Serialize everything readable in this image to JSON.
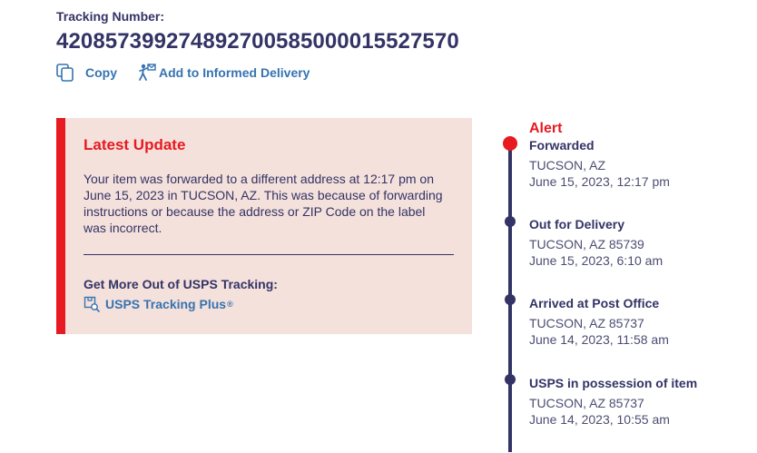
{
  "tracking": {
    "label": "Tracking Number:",
    "number": "420857399274892700585000015527570"
  },
  "actions": {
    "copy": "Copy",
    "informed_delivery": "Add to Informed Delivery"
  },
  "latest_update": {
    "title": "Latest Update",
    "text": "Your item was forwarded to a different address at 12:17 pm on June 15, 2023 in TUCSON, AZ. This was because of forwarding instructions or because the address or ZIP Code on the label was incorrect.",
    "more_title": "Get More Out of USPS Tracking:",
    "plus_link": "USPS Tracking Plus",
    "plus_mark": "®"
  },
  "timeline": [
    {
      "alert": "Alert",
      "status": "Forwarded",
      "location": "TUCSON, AZ",
      "datetime": "June 15, 2023, 12:17 pm"
    },
    {
      "status": "Out for Delivery",
      "location": "TUCSON, AZ 85739",
      "datetime": "June 15, 2023, 6:10 am"
    },
    {
      "status": "Arrived at Post Office",
      "location": "TUCSON, AZ 85737",
      "datetime": "June 14, 2023, 11:58 am"
    },
    {
      "status": "USPS in possession of item",
      "location": "TUCSON, AZ 85737",
      "datetime": "June 14, 2023, 10:55 am"
    }
  ],
  "colors": {
    "navy": "#333366",
    "red": "#e71921",
    "link_blue": "#3573b1",
    "card_bg": "#f5e1db"
  },
  "icons": {
    "copy": "copy-icon",
    "informed_delivery": "person-mail-icon",
    "tracking_plus": "package-search-icon"
  }
}
